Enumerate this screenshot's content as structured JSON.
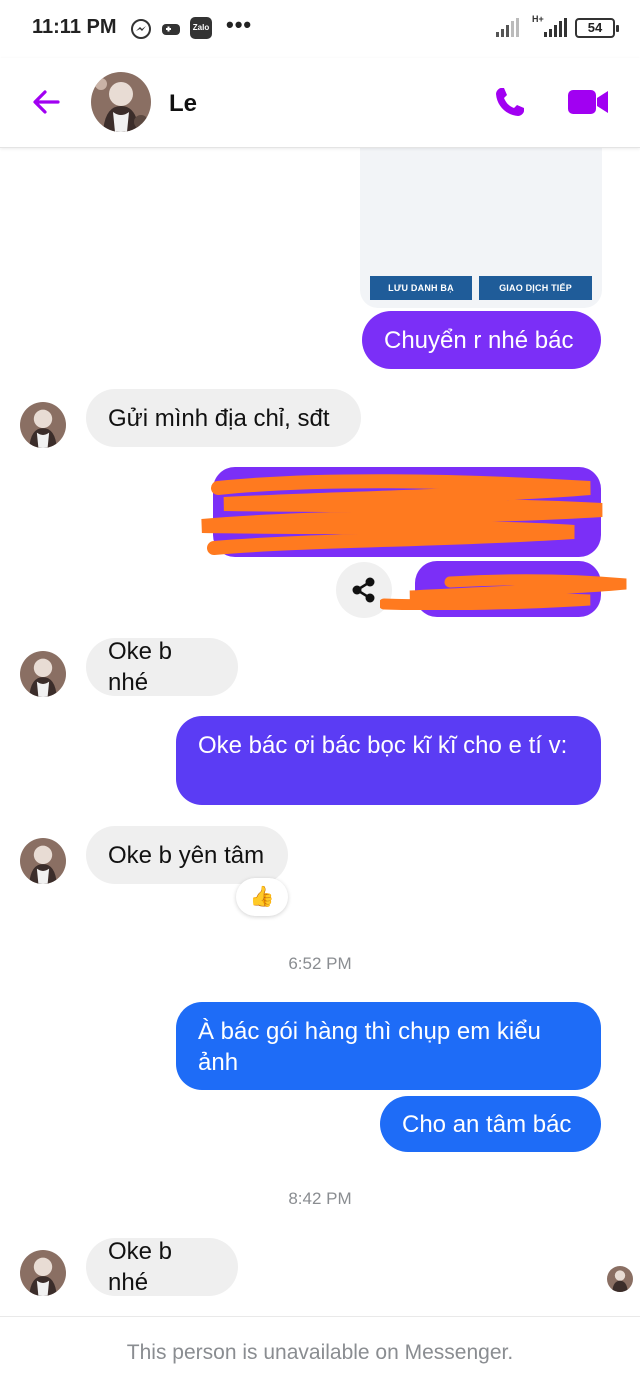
{
  "status_bar": {
    "time": "11:11 PM",
    "battery": "54",
    "network": "H+",
    "zalo_label": "Zalo",
    "icons": [
      "messenger-icon",
      "game-icon",
      "zalo-icon",
      "more-dots-icon",
      "signal-icon",
      "battery-icon"
    ]
  },
  "header": {
    "contact_name": "Le",
    "icons": [
      "back-arrow-icon",
      "phone-icon",
      "video-camera-icon"
    ],
    "accent_color": "#a100f2"
  },
  "card": {
    "save_contact_label": "LƯU DANH BẠ",
    "continue_label": "GIAO DỊCH TIẾP"
  },
  "messages": [
    {
      "sender": "me",
      "text": "Chuyển r nhé bác",
      "color": "#7b2ff7"
    },
    {
      "sender": "them",
      "text": "Gửi mình địa chỉ, sđt"
    },
    {
      "sender": "me",
      "text": "",
      "note_hidden": true
    },
    {
      "sender": "me",
      "text": "",
      "note_hidden": true
    },
    {
      "sender": "them",
      "text": "Oke b nhé"
    },
    {
      "sender": "me",
      "text": "Oke bác ơi bác bọc kĩ kĩ cho e tí v:",
      "color": "#5b3cf4"
    },
    {
      "sender": "them",
      "text": "Oke b yên tâm",
      "reaction": "👍"
    },
    {
      "sender": "me",
      "text": "À bác gói hàng thì chụp em kiểu ảnh",
      "color": "#1e6cf7"
    },
    {
      "sender": "me",
      "text": "Cho an tâm bác",
      "color": "#1e6cf7"
    },
    {
      "sender": "them",
      "text": "Oke b nhé"
    }
  ],
  "timestamps": [
    "6:52 PM",
    "8:42 PM"
  ],
  "footer": {
    "unavailable_text": "This person is unavailable on Messenger."
  }
}
